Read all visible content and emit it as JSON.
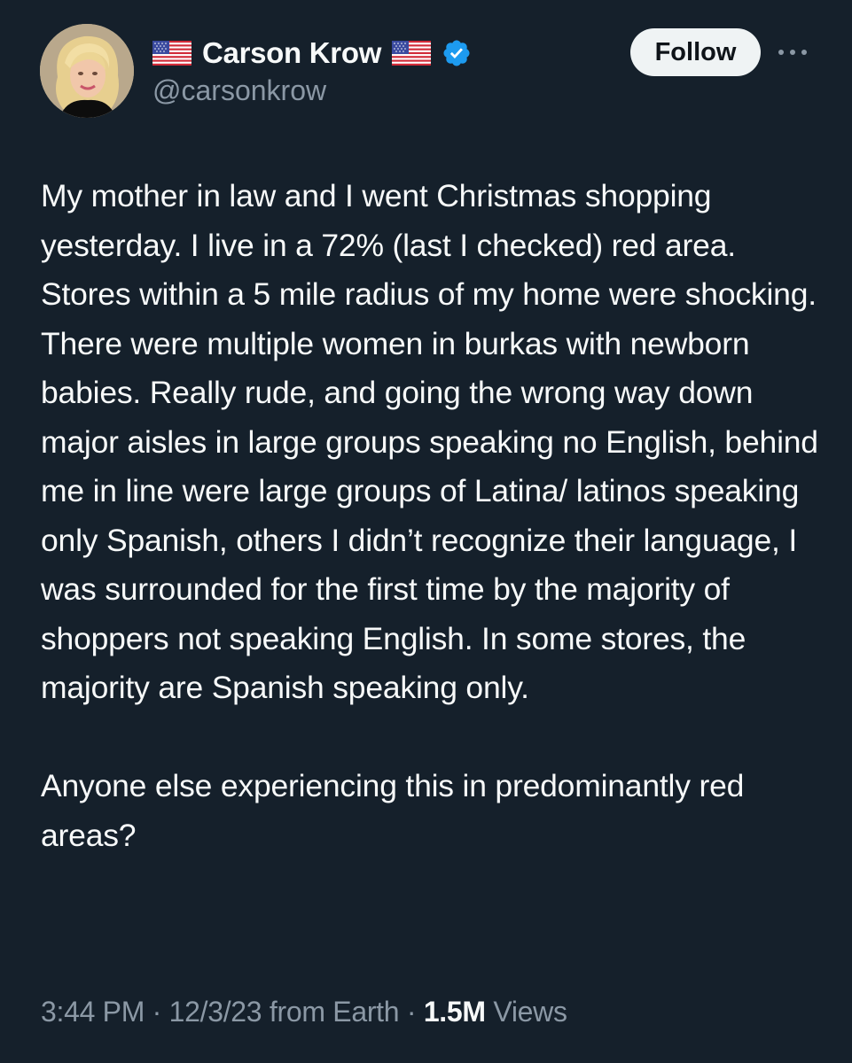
{
  "author": {
    "display_name": "Carson Krow",
    "handle": "@carsonkrow",
    "verified": true,
    "flag_icon": "us-flag-icon",
    "avatar_icon": "avatar"
  },
  "actions": {
    "follow_label": "Follow",
    "more_icon": "more-dots-icon"
  },
  "tweet": {
    "text": "My mother in law and I went Christmas shopping yesterday. I live in a 72% (last I checked) red area. Stores within a 5 mile radius of my home were shocking. There were multiple women in burkas with newborn babies. Really rude, and going the wrong way down major aisles in large groups speaking no English, behind me in line were large groups of Latina/ latinos speaking only Spanish, others I didn’t recognize their language, I was surrounded for the first time by the majority of shoppers not speaking English. In some stores, the majority are Spanish speaking only.\n\nAnyone else experiencing this in predominantly red areas?"
  },
  "meta": {
    "time": "3:44 PM",
    "separator": " · ",
    "date": "12/3/23",
    "source": " from Earth",
    "views_count": "1.5M",
    "views_label": " Views"
  },
  "colors": {
    "background": "#15202b",
    "text_primary": "#f7f9f9",
    "text_secondary": "#8b98a5",
    "verified_blue": "#1d9bf0",
    "follow_bg": "#eff3f4"
  }
}
